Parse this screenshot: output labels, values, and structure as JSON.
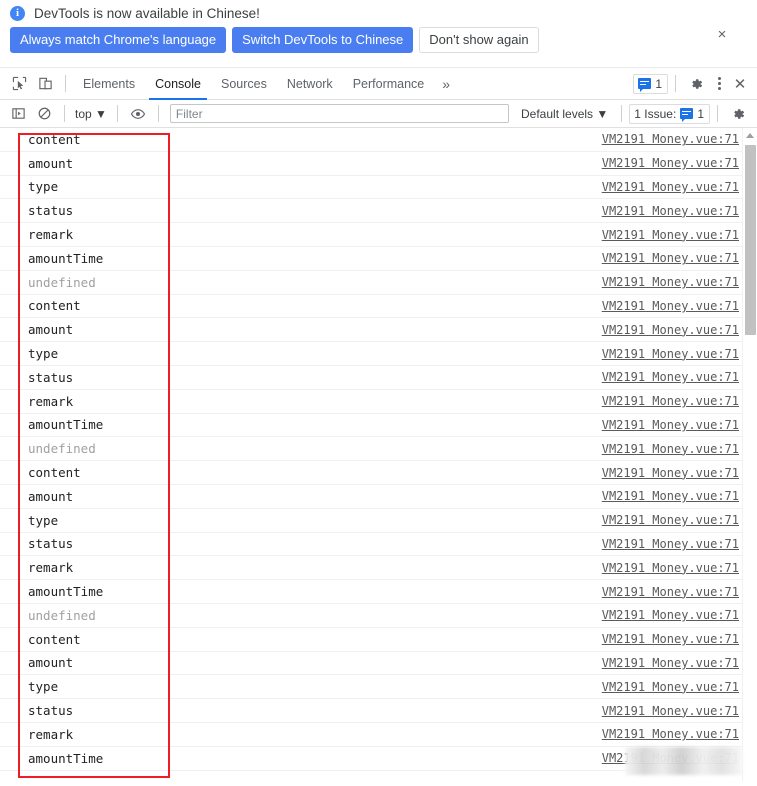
{
  "banner": {
    "info_icon": "info-icon",
    "message": "DevTools is now available in Chinese!",
    "buttons": [
      {
        "label": "Always match Chrome's language",
        "style": "primary"
      },
      {
        "label": "Switch DevTools to Chinese",
        "style": "primary"
      },
      {
        "label": "Don't show again",
        "style": "secondary"
      }
    ],
    "close_label": "×"
  },
  "tabbar": {
    "inspect_icon": "inspect-element-icon",
    "device_icon": "device-toolbar-icon",
    "tabs": [
      {
        "label": "Elements",
        "active": false
      },
      {
        "label": "Console",
        "active": true
      },
      {
        "label": "Sources",
        "active": false
      },
      {
        "label": "Network",
        "active": false
      },
      {
        "label": "Performance",
        "active": false
      }
    ],
    "more_label": "»",
    "messages_count": "1",
    "settings_icon": "gear-icon",
    "kebab_icon": "more-options-icon",
    "close_label": "✕"
  },
  "filterbar": {
    "sidebar_icon": "console-sidebar-icon",
    "clear_icon": "clear-console-icon",
    "context": "top",
    "context_caret": "▼",
    "eye_icon": "live-expression-icon",
    "filter_placeholder": "Filter",
    "filter_value": "",
    "levels_label": "Default levels",
    "levels_caret": "▼",
    "issues_label": "1 Issue:",
    "issues_count": "1",
    "settings_icon": "console-settings-icon"
  },
  "console": {
    "source_link": "VM2191 Money.vue:71",
    "rows": [
      {
        "message": "content",
        "undefined": false,
        "source": "VM2191 Money.vue:71"
      },
      {
        "message": "amount",
        "undefined": false,
        "source": "VM2191 Money.vue:71"
      },
      {
        "message": "type",
        "undefined": false,
        "source": "VM2191 Money.vue:71"
      },
      {
        "message": "status",
        "undefined": false,
        "source": "VM2191 Money.vue:71"
      },
      {
        "message": "remark",
        "undefined": false,
        "source": "VM2191 Money.vue:71"
      },
      {
        "message": "amountTime",
        "undefined": false,
        "source": "VM2191 Money.vue:71"
      },
      {
        "message": "undefined",
        "undefined": true,
        "source": "VM2191 Money.vue:71"
      },
      {
        "message": "content",
        "undefined": false,
        "source": "VM2191 Money.vue:71"
      },
      {
        "message": "amount",
        "undefined": false,
        "source": "VM2191 Money.vue:71"
      },
      {
        "message": "type",
        "undefined": false,
        "source": "VM2191 Money.vue:71"
      },
      {
        "message": "status",
        "undefined": false,
        "source": "VM2191 Money.vue:71"
      },
      {
        "message": "remark",
        "undefined": false,
        "source": "VM2191 Money.vue:71"
      },
      {
        "message": "amountTime",
        "undefined": false,
        "source": "VM2191 Money.vue:71"
      },
      {
        "message": "undefined",
        "undefined": true,
        "source": "VM2191 Money.vue:71"
      },
      {
        "message": "content",
        "undefined": false,
        "source": "VM2191 Money.vue:71"
      },
      {
        "message": "amount",
        "undefined": false,
        "source": "VM2191 Money.vue:71"
      },
      {
        "message": "type",
        "undefined": false,
        "source": "VM2191 Money.vue:71"
      },
      {
        "message": "status",
        "undefined": false,
        "source": "VM2191 Money.vue:71"
      },
      {
        "message": "remark",
        "undefined": false,
        "source": "VM2191 Money.vue:71"
      },
      {
        "message": "amountTime",
        "undefined": false,
        "source": "VM2191 Money.vue:71"
      },
      {
        "message": "undefined",
        "undefined": true,
        "source": "VM2191 Money.vue:71"
      },
      {
        "message": "content",
        "undefined": false,
        "source": "VM2191 Money.vue:71"
      },
      {
        "message": "amount",
        "undefined": false,
        "source": "VM2191 Money.vue:71"
      },
      {
        "message": "type",
        "undefined": false,
        "source": "VM2191 Money.vue:71"
      },
      {
        "message": "status",
        "undefined": false,
        "source": "VM2191 Money.vue:71"
      },
      {
        "message": "remark",
        "undefined": false,
        "source": "VM2191 Money.vue:71"
      },
      {
        "message": "amountTime",
        "undefined": false,
        "source": "VM2191 Money.vue:71"
      }
    ]
  },
  "annotation": {
    "rect_color": "#ee1c25"
  },
  "colors": {
    "accent_blue": "#1a73e8",
    "button_blue": "#4a7ef0",
    "text": "#202124",
    "muted": "#5f6368",
    "undefined_grey": "#a0a0a0"
  }
}
